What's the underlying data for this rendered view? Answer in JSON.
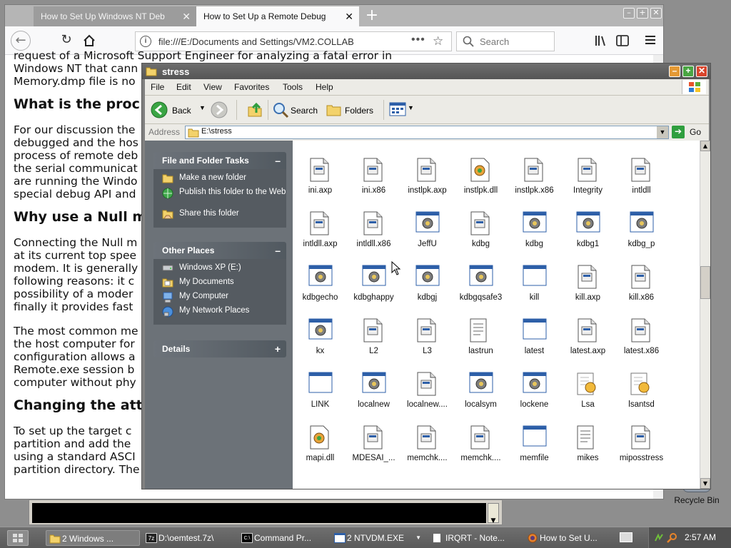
{
  "desktop": {
    "recycle_bin_label": "Recycle Bin"
  },
  "browser": {
    "tabs": [
      {
        "title": "How to Set Up Windows NT Deb"
      },
      {
        "title": "How to Set Up a Remote Debug"
      }
    ],
    "url": "file:///E:/Documents and Settings/VM2.COLLAB",
    "search_placeholder": "Search",
    "page_lines": {
      "l1": "request of a Microsoft Support Engineer for analyzing a fatal error in",
      "l2": "Windows NT that cann",
      "l3": "Memory.dmp file is no",
      "h1": "What is the proc",
      "p2_1": "For our discussion the",
      "p2_2": "debugged and the hos",
      "p2_3": "process of remote deb",
      "p2_4": "the serial communicat",
      "p2_5": "are running the Windo",
      "p2_6": "special debug API and",
      "h2": "Why use a Null m",
      "p3_1": "Connecting the Null m",
      "p3_2": "at its current top spee",
      "p3_3": "modem. It is generally",
      "p3_4": "following reasons: it c",
      "p3_5": "possibility of a moder",
      "p3_6": "finally it provides fast",
      "p4_1": "The most common me",
      "p4_2": "the host computer for",
      "p4_3": "configuration allows a",
      "p4_4": "Remote.exe session b",
      "p4_5": "computer without phy",
      "h3": "Changing the att",
      "p5_1": "To set up the target c",
      "p5_2": "partition and add the",
      "p5_3": "using a standard ASCI",
      "p5_4": "partition directory. The Boot.ini attributes are hidden, read-only and system."
    }
  },
  "explorer": {
    "title": "stress",
    "menu": [
      "File",
      "Edit",
      "View",
      "Favorites",
      "Tools",
      "Help"
    ],
    "toolbar": {
      "back": "Back",
      "search": "Search",
      "folders": "Folders"
    },
    "address_label": "Address",
    "address_value": "E:\\stress",
    "go_label": "Go",
    "tasks_panel": {
      "title": "File and Folder Tasks",
      "items": [
        "Make a new folder",
        "Publish this folder to the Web",
        "Share this folder"
      ]
    },
    "places_panel": {
      "title": "Other Places",
      "items": [
        "Windows XP (E:)",
        "My Documents",
        "My Computer",
        "My Network Places"
      ]
    },
    "details_panel": {
      "title": "Details"
    },
    "files": [
      {
        "name": "ini.axp",
        "type": "doc"
      },
      {
        "name": "ini.x86",
        "type": "doc"
      },
      {
        "name": "instlpk.axp",
        "type": "doc"
      },
      {
        "name": "instlpk.dll",
        "type": "dll"
      },
      {
        "name": "instlpk.x86",
        "type": "doc"
      },
      {
        "name": "Integrity",
        "type": "doc"
      },
      {
        "name": "intldll",
        "type": "doc"
      },
      {
        "name": "intldll.axp",
        "type": "doc"
      },
      {
        "name": "intldll.x86",
        "type": "doc"
      },
      {
        "name": "JeffU",
        "type": "exe"
      },
      {
        "name": "kdbg",
        "type": "doc"
      },
      {
        "name": "kdbg",
        "type": "exe"
      },
      {
        "name": "kdbg1",
        "type": "exe"
      },
      {
        "name": "kdbg_p",
        "type": "exe"
      },
      {
        "name": "kdbgecho",
        "type": "exe"
      },
      {
        "name": "kdbghappy",
        "type": "exe"
      },
      {
        "name": "kdbgj",
        "type": "exe"
      },
      {
        "name": "kdbgqsafe3",
        "type": "exe"
      },
      {
        "name": "kill",
        "type": "win"
      },
      {
        "name": "kill.axp",
        "type": "doc"
      },
      {
        "name": "kill.x86",
        "type": "doc"
      },
      {
        "name": "kx",
        "type": "exe"
      },
      {
        "name": "L2",
        "type": "doc"
      },
      {
        "name": "L3",
        "type": "doc"
      },
      {
        "name": "lastrun",
        "type": "txt"
      },
      {
        "name": "latest",
        "type": "win"
      },
      {
        "name": "latest.axp",
        "type": "doc"
      },
      {
        "name": "latest.x86",
        "type": "doc"
      },
      {
        "name": "LINK",
        "type": "win"
      },
      {
        "name": "localnew",
        "type": "exe"
      },
      {
        "name": "localnew....",
        "type": "doc"
      },
      {
        "name": "localsym",
        "type": "exe"
      },
      {
        "name": "lockene",
        "type": "exe"
      },
      {
        "name": "Lsa",
        "type": "cfg"
      },
      {
        "name": "lsantsd",
        "type": "cfg"
      },
      {
        "name": "mapi.dll",
        "type": "dll"
      },
      {
        "name": "MDESAI_...",
        "type": "doc"
      },
      {
        "name": "memchk....",
        "type": "doc"
      },
      {
        "name": "memchk....",
        "type": "doc"
      },
      {
        "name": "memfile",
        "type": "win"
      },
      {
        "name": "mikes",
        "type": "txt"
      },
      {
        "name": "miposstress",
        "type": "doc"
      }
    ]
  },
  "taskbar": {
    "items": [
      "2 Windows ...",
      "D:\\oemtest.7z\\",
      "Command Pr...",
      "2 NTVDM.EXE",
      "IRQRT - Note...",
      "How to Set U..."
    ],
    "clock": "2:57 AM"
  }
}
